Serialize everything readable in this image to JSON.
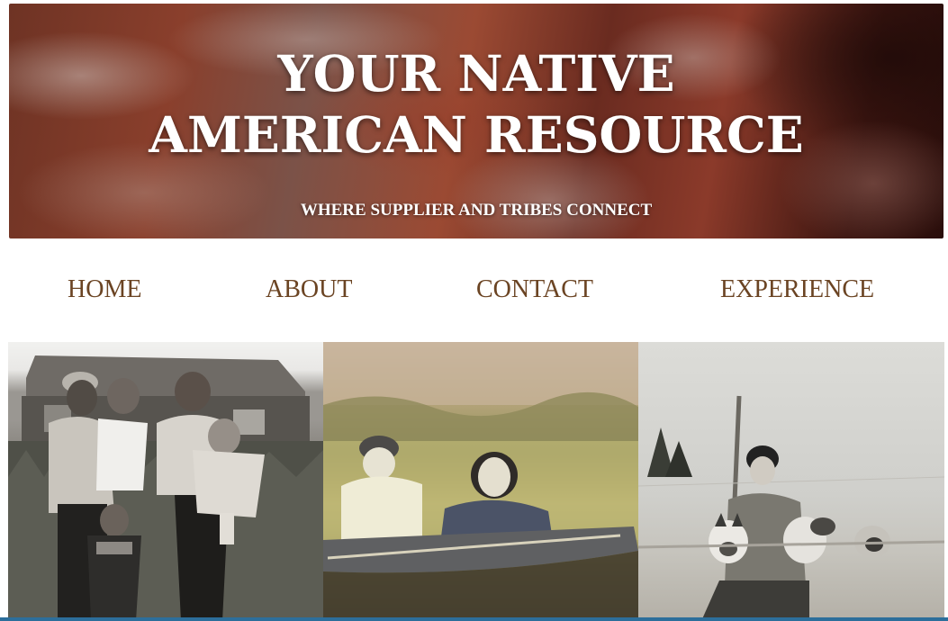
{
  "banner": {
    "title": "YOUR NATIVE AMERICAN RESOURCE",
    "tagline": "WHERE SUPPLIER AND TRIBES CONNECT"
  },
  "nav": {
    "items": [
      {
        "label": "HOME"
      },
      {
        "label": "ABOUT"
      },
      {
        "label": "CONTACT"
      },
      {
        "label": "EXPERIENCE"
      }
    ]
  },
  "photos": [
    {
      "subject": "family-photo"
    },
    {
      "subject": "canoe-photo"
    },
    {
      "subject": "sled-dogs-photo"
    }
  ],
  "colors": {
    "nav_text": "#6b4423",
    "banner_text": "#ffffff",
    "bottom_bar": "#2c6e9b"
  }
}
